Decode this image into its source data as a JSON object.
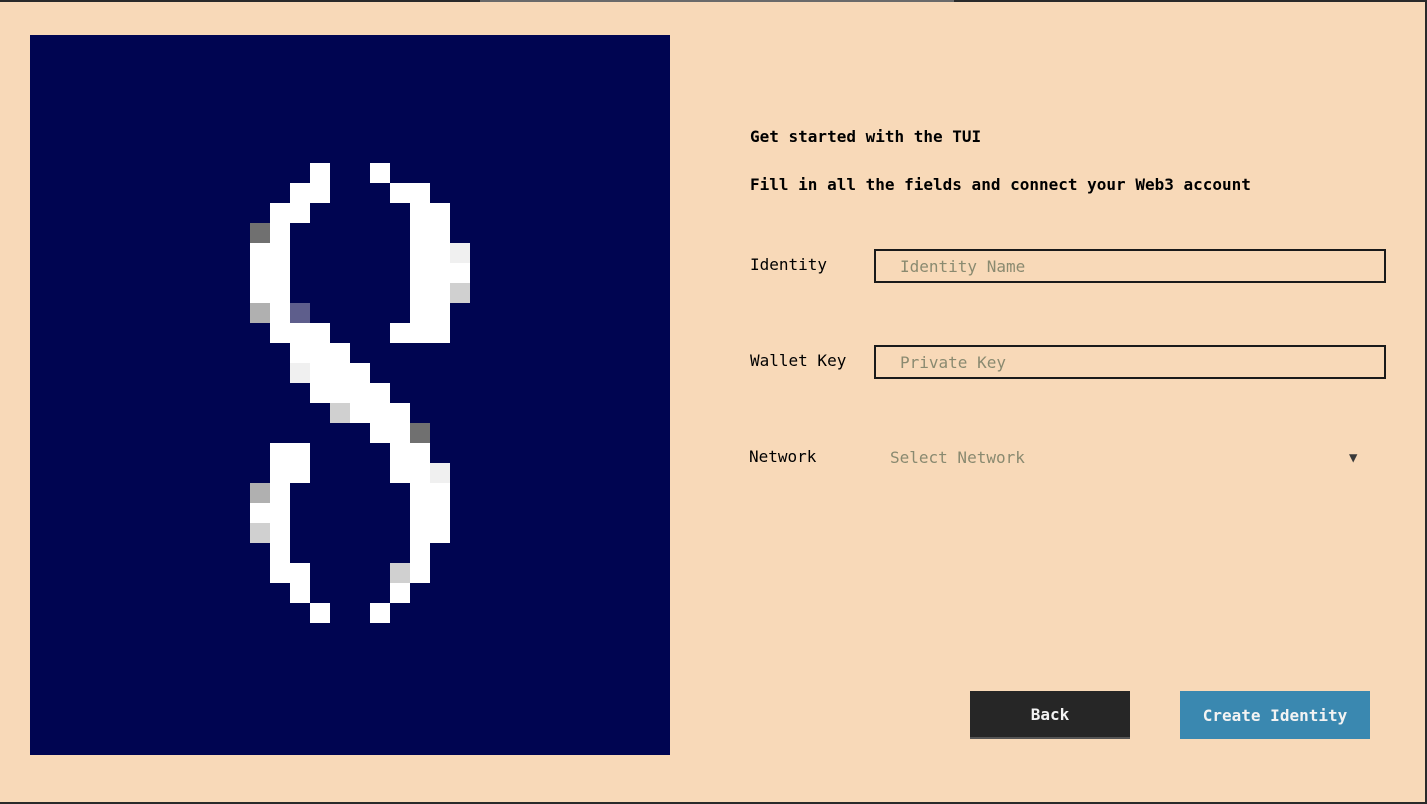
{
  "intro": {
    "title": "Get started with the TUI",
    "subtitle": "Fill in all the fields and connect your Web3 account"
  },
  "form": {
    "identity": {
      "label": "Identity",
      "placeholder": "Identity Name",
      "value": ""
    },
    "wallet_key": {
      "label": "Wallet Key",
      "placeholder": "Private Key",
      "value": ""
    },
    "network": {
      "label": "Network",
      "selected": "Select Network",
      "arrow_icon": "triangle-down-icon"
    }
  },
  "actions": {
    "back_label": "Back",
    "create_label": "Create Identity"
  },
  "pixel_art": {
    "description_icon": "digit-eight-pixel-art",
    "background_color": "#000551",
    "pixel_color": "#ffffff"
  },
  "colors": {
    "page_background": "#f8d9b8",
    "back_button": "#262626",
    "create_button": "#3a88b0",
    "placeholder_text": "#8a8a70"
  }
}
